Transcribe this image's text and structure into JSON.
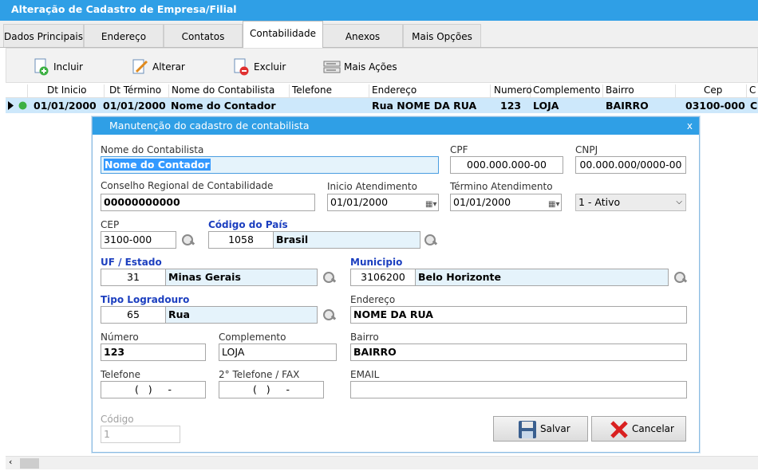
{
  "window": {
    "title": "Alteração de Cadastro de Empresa/Filial"
  },
  "tabs": [
    "Dados Principais",
    "Endereço",
    "Contatos",
    "Contabilidade",
    "Anexos",
    "Mais Opções"
  ],
  "toolbar": {
    "incluir": "Incluir",
    "alterar": "Alterar",
    "excluir": "Excluir",
    "mais_acoes": "Mais Ações"
  },
  "grid": {
    "headers": [
      "Dt Inicio",
      "Dt Término",
      "Nome do Contabilista",
      "Telefone",
      "Endereço",
      "Numero",
      "Complemento",
      "Bairro",
      "Cep",
      "C"
    ],
    "row": [
      "01/01/2000",
      "01/01/2000",
      "Nome do Contador",
      "",
      "Rua NOME DA RUA",
      "123",
      "LOJA",
      "BAIRRO",
      "03100-000",
      "C"
    ]
  },
  "dialog": {
    "title": "Manutenção do cadastro de contabilista",
    "close": "x",
    "nome_label": "Nome do Contabilista",
    "nome_value": "Nome do Contador",
    "cpf_label": "CPF",
    "cpf_value": "000.000.000-00",
    "cnpj_label": "CNPJ",
    "cnpj_value": "00.000.000/0000-00",
    "crc_label": "Conselho Regional de Contabilidade",
    "crc_value": "00000000000",
    "inicio_label": "Inicio Atendimento",
    "inicio_value": "01/01/2000",
    "termino_label": "Término Atendimento",
    "termino_value": "01/01/2000",
    "status_value": "1 - Ativo",
    "cep_label": "CEP",
    "cep_value": "3100-000",
    "pais_label": "Código do País",
    "pais_code": "1058",
    "pais_name": "Brasil",
    "uf_label": "UF / Estado",
    "uf_code": "31",
    "uf_name": "Minas Gerais",
    "mun_label": "Municipio",
    "mun_code": "3106200",
    "mun_name": "Belo Horizonte",
    "tipo_label": "Tipo Logradouro",
    "tipo_code": "65",
    "tipo_name": "Rua",
    "end_label": "Endereço",
    "end_value": "NOME DA RUA",
    "num_label": "Número",
    "num_value": "123",
    "comp_label": "Complemento",
    "comp_value": "LOJA",
    "bairro_label": "Bairro",
    "bairro_value": "BAIRRO",
    "tel_label": "Telefone",
    "tel_value": "(   )     -",
    "tel2_label": "2° Telefone / FAX",
    "tel2_value": "(   )     -",
    "email_label": "EMAIL",
    "email_value": "",
    "codigo_label": "Código",
    "codigo_value": "1",
    "salvar": "Salvar",
    "cancelar": "Cancelar"
  }
}
